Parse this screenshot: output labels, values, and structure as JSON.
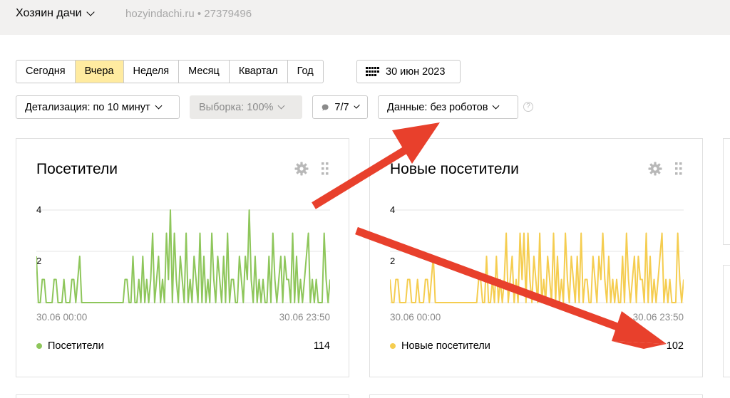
{
  "header": {
    "site_name": "Хозяин дачи",
    "site_meta": "hozyindachi.ru • 27379496"
  },
  "periods": [
    "Сегодня",
    "Вчера",
    "Неделя",
    "Месяц",
    "Квартал",
    "Год"
  ],
  "active_period": "Вчера",
  "date_button": {
    "icon": "calendar-grid-icon",
    "label": "30 июн 2023"
  },
  "filters": {
    "detail": "Детализация: по 10 минут",
    "sample": "Выборка: 100%",
    "segments": "7/7",
    "data": "Данные: без роботов",
    "help": "?"
  },
  "cards": [
    {
      "title": "Посетители",
      "legend": "Посетители",
      "total": "114",
      "color": "#8ec65b",
      "x_start": "30.06 00:00",
      "x_end": "30.06 23:50",
      "y_ticks": [
        "4",
        "2"
      ]
    },
    {
      "title": "Новые посетители",
      "legend": "Новые посетители",
      "total": "102",
      "color": "#f5cd50",
      "x_start": "30.06 00:00",
      "x_end": "30.06 23:50",
      "y_ticks": [
        "4",
        "2"
      ]
    }
  ],
  "chart_data": [
    {
      "type": "line",
      "series": [
        {
          "name": "Посетители",
          "values": [
            2,
            0,
            0,
            1,
            1,
            0,
            0,
            0,
            0,
            1,
            1,
            0,
            0,
            0,
            1,
            0,
            0,
            0,
            1,
            1,
            0,
            1,
            2,
            0,
            0,
            0,
            0,
            0,
            0,
            0,
            0,
            0,
            0,
            0,
            0,
            0,
            0,
            0,
            0,
            0,
            0,
            0,
            0,
            0,
            0,
            1,
            1,
            0,
            0,
            2,
            0,
            0,
            1,
            0,
            2,
            0,
            1,
            0,
            1,
            3,
            0,
            1,
            2,
            0,
            1,
            0,
            3,
            1,
            4,
            0,
            3,
            1,
            0,
            2,
            1,
            0,
            3,
            0,
            1,
            0,
            2,
            1,
            0,
            3,
            0,
            2,
            0,
            1,
            0,
            3,
            1,
            0,
            2,
            1,
            0,
            2,
            0,
            3,
            0,
            1,
            1,
            0,
            0,
            2,
            1,
            0,
            2,
            1,
            4,
            1,
            0,
            2,
            0,
            1,
            0,
            1,
            0,
            0,
            2,
            0,
            3,
            1,
            0,
            1,
            2,
            0,
            2,
            1,
            1,
            0,
            3,
            0,
            2,
            0,
            1,
            0,
            1,
            2,
            3,
            0,
            1,
            0,
            1,
            0,
            0,
            0,
            3,
            1,
            0,
            1
          ]
        }
      ],
      "ylim": [
        0,
        4
      ],
      "xlabel": "",
      "ylabel": ""
    },
    {
      "type": "line",
      "series": [
        {
          "name": "Новые посетители",
          "values": [
            1,
            0,
            0,
            1,
            1,
            0,
            0,
            0,
            0,
            1,
            1,
            0,
            0,
            0,
            1,
            0,
            0,
            0,
            1,
            1,
            0,
            1,
            2,
            0,
            0,
            0,
            0,
            0,
            0,
            0,
            0,
            0,
            0,
            0,
            0,
            0,
            0,
            0,
            0,
            0,
            0,
            0,
            0,
            0,
            0,
            1,
            1,
            0,
            0,
            2,
            0,
            0,
            1,
            0,
            2,
            0,
            1,
            0,
            1,
            3,
            0,
            1,
            2,
            0,
            1,
            0,
            3,
            1,
            3,
            0,
            3,
            1,
            0,
            2,
            1,
            0,
            3,
            0,
            1,
            0,
            2,
            1,
            0,
            3,
            0,
            2,
            0,
            1,
            0,
            3,
            1,
            0,
            2,
            1,
            0,
            2,
            0,
            3,
            0,
            1,
            1,
            0,
            0,
            2,
            1,
            0,
            2,
            1,
            3,
            1,
            0,
            2,
            0,
            1,
            0,
            1,
            0,
            0,
            2,
            0,
            3,
            1,
            0,
            1,
            2,
            0,
            2,
            1,
            1,
            0,
            3,
            0,
            2,
            0,
            1,
            0,
            1,
            2,
            3,
            0,
            1,
            0,
            1,
            0,
            0,
            0,
            3,
            1,
            0,
            1
          ]
        }
      ],
      "ylim": [
        0,
        4
      ],
      "xlabel": "",
      "ylabel": ""
    }
  ]
}
